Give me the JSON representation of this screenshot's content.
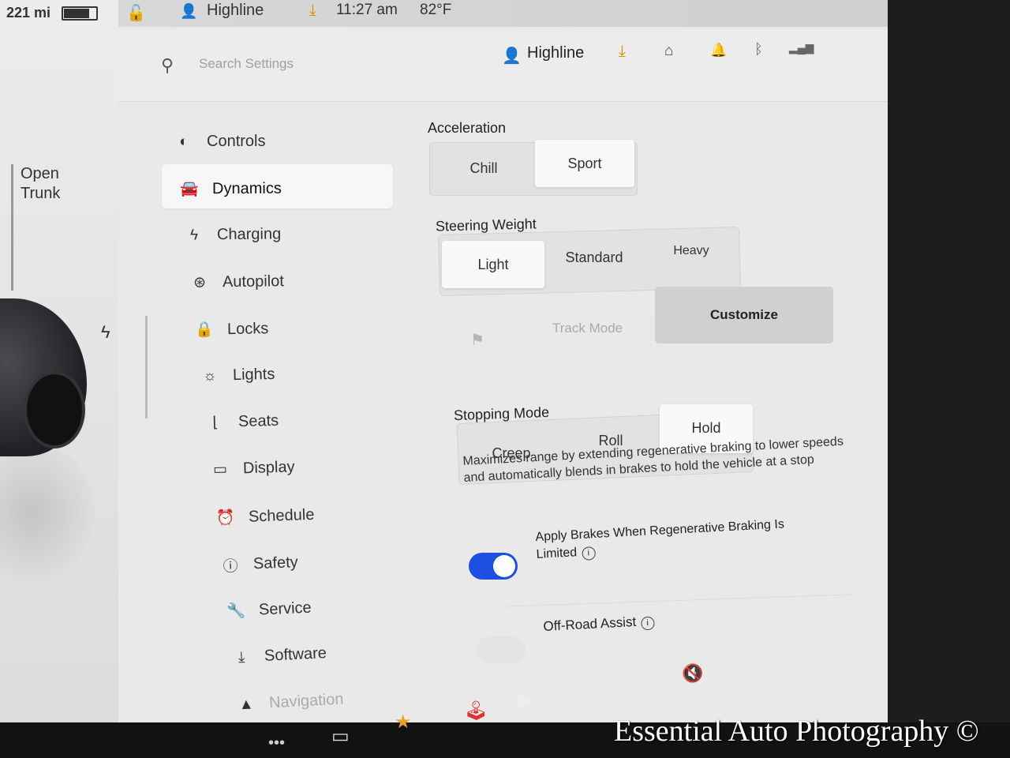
{
  "status_bar": {
    "range": "221 mi",
    "profile": "Highline",
    "time": "11:27 am",
    "temperature": "82°F",
    "battery_level": 0.8
  },
  "car_panel": {
    "open_trunk": "Open\nTrunk"
  },
  "header": {
    "search_placeholder": "Search Settings",
    "profile": "Highline"
  },
  "sidebar": {
    "items": [
      {
        "label": "Controls",
        "icon": "toggle-icon"
      },
      {
        "label": "Dynamics",
        "icon": "car-icon",
        "active": true
      },
      {
        "label": "Charging",
        "icon": "bolt-icon"
      },
      {
        "label": "Autopilot",
        "icon": "steering-wheel-icon"
      },
      {
        "label": "Locks",
        "icon": "lock-icon"
      },
      {
        "label": "Lights",
        "icon": "light-icon"
      },
      {
        "label": "Seats",
        "icon": "seat-icon"
      },
      {
        "label": "Display",
        "icon": "display-icon"
      },
      {
        "label": "Schedule",
        "icon": "alarm-icon"
      },
      {
        "label": "Safety",
        "icon": "safety-icon"
      },
      {
        "label": "Service",
        "icon": "wrench-icon"
      },
      {
        "label": "Software",
        "icon": "download-icon"
      },
      {
        "label": "Navigation",
        "icon": "navigation-icon"
      }
    ]
  },
  "dynamics": {
    "acceleration": {
      "label": "Acceleration",
      "options": [
        "Chill",
        "Sport"
      ],
      "selected": "Sport"
    },
    "steering_weight": {
      "label": "Steering Weight",
      "options": [
        "Light",
        "Standard",
        "Heavy"
      ],
      "selected": "Light"
    },
    "track_mode": {
      "label": "Track Mode",
      "customize": "Customize"
    },
    "stopping_mode": {
      "label": "Stopping Mode",
      "options": [
        "Creep",
        "Roll",
        "Hold"
      ],
      "selected": "Hold",
      "description": "Maximizes range by extending regenerative braking to lower speeds and automatically blends in brakes to hold the vehicle at a stop"
    },
    "apply_brakes": {
      "label": "Apply Brakes When Regenerative Braking Is Limited",
      "enabled": true
    },
    "off_road_assist": {
      "label": "Off-Road Assist",
      "enabled": false
    }
  },
  "watermark": "Essential Auto Photography ©",
  "colors": {
    "accent": "#1d4fe0",
    "download": "#e08a00",
    "screen_bg": "#e9e9e9"
  }
}
